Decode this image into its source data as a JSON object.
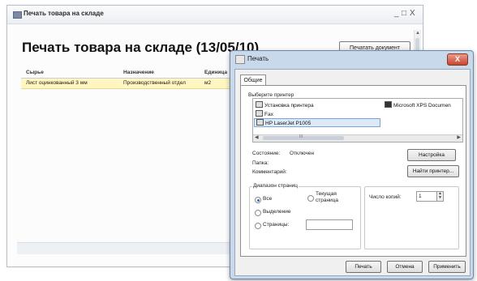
{
  "main_window": {
    "title": "Печать товара на складе",
    "controls": {
      "minimize": "_",
      "maximize": "□",
      "close": "X"
    },
    "heading": "Печать товара на складе (13/05/10)",
    "print_button": "Печатать документ",
    "table": {
      "columns": [
        "Сырье",
        "Назначение",
        "Единица"
      ],
      "rows": [
        {
          "material": "Лист оцинкованный 3 мм",
          "purpose": "Производственный отдел",
          "unit": "м2"
        }
      ]
    }
  },
  "print_dialog": {
    "title": "Печать",
    "close_label": "X",
    "tab": "Общие",
    "select_printer_label": "Выберите принтер",
    "printers": [
      {
        "name": "Установка принтера",
        "icon": "add-printer-icon"
      },
      {
        "name": "Microsoft XPS Documen",
        "icon": "xps-printer-icon"
      },
      {
        "name": "Fax",
        "icon": "fax-icon"
      },
      {
        "name": "HP LaserJet P1005",
        "icon": "printer-icon",
        "selected": true
      }
    ],
    "scroll_grip": "III",
    "status_label": "Состояние:",
    "status_value": "Отключен",
    "location_label": "Папка:",
    "comment_label": "Комментарий:",
    "preferences_button": "Настройка",
    "find_printer_button": "Найти принтер...",
    "page_range": {
      "label": "Диапазон страниц",
      "all": "Все",
      "selection": "Выделение",
      "current_page": "Текущая страница",
      "pages": "Страницы:",
      "selected_option": "Все"
    },
    "copies_label": "Число копий:",
    "copies_value": "1",
    "buttons": {
      "print": "Печать",
      "cancel": "Отмена",
      "apply": "Применить"
    }
  }
}
